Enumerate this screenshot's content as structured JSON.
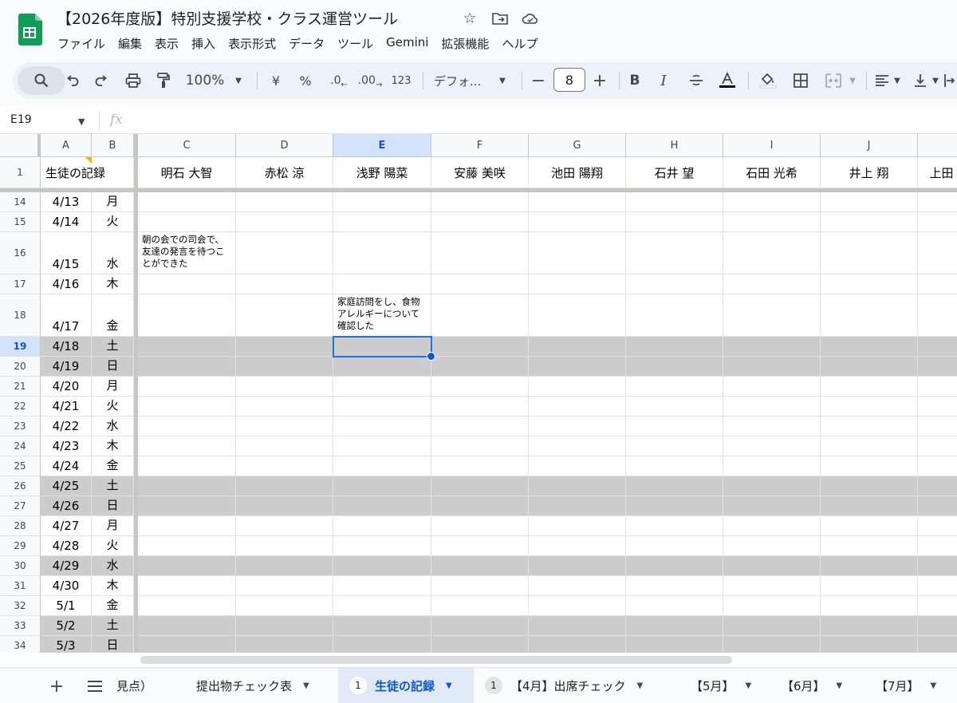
{
  "app": {
    "doc_title": "【2026年度版】特別支援学校・クラス運営ツール",
    "menu": [
      "ファイル",
      "編集",
      "表示",
      "挿入",
      "表示形式",
      "データ",
      "ツール",
      "Gemini",
      "拡張機能",
      "ヘルプ"
    ]
  },
  "toolbar": {
    "zoom": "100%",
    "currency": "¥",
    "percent": "%",
    "dec_decrease": ".0",
    "dec_increase": ".00",
    "number_format": "123",
    "font": "デフォ...",
    "font_size": "8"
  },
  "formula_bar": {
    "name_box": "E19",
    "fx_label": "fx",
    "formula": ""
  },
  "grid": {
    "col_headers": [
      "A",
      "B",
      "C",
      "D",
      "E",
      "F",
      "G",
      "H",
      "I",
      "J"
    ],
    "selected_col": "E",
    "header_row": {
      "row_num": "1",
      "label": "生徒の記録",
      "names": [
        "明石 大智",
        "赤松 涼",
        "浅野 陽菜",
        "安藤 美咲",
        "池田 陽翔",
        "石井 望",
        "石田 光希",
        "井上 翔",
        "上田"
      ]
    },
    "rows": [
      {
        "num": "14",
        "date": "4/13",
        "day": "月",
        "gray": false
      },
      {
        "num": "15",
        "date": "4/14",
        "day": "火",
        "gray": false
      },
      {
        "num": "16",
        "date": "4/15",
        "day": "水",
        "gray": false
      },
      {
        "num": "17",
        "date": "4/16",
        "day": "木",
        "gray": false
      },
      {
        "num": "18",
        "date": "4/17",
        "day": "金",
        "gray": false
      },
      {
        "num": "19",
        "date": "4/18",
        "day": "土",
        "gray": true
      },
      {
        "num": "20",
        "date": "4/19",
        "day": "日",
        "gray": true
      },
      {
        "num": "21",
        "date": "4/20",
        "day": "月",
        "gray": false
      },
      {
        "num": "22",
        "date": "4/21",
        "day": "火",
        "gray": false
      },
      {
        "num": "23",
        "date": "4/22",
        "day": "水",
        "gray": false
      },
      {
        "num": "24",
        "date": "4/23",
        "day": "木",
        "gray": false
      },
      {
        "num": "25",
        "date": "4/24",
        "day": "金",
        "gray": false
      },
      {
        "num": "26",
        "date": "4/25",
        "day": "土",
        "gray": true
      },
      {
        "num": "27",
        "date": "4/26",
        "day": "日",
        "gray": true
      },
      {
        "num": "28",
        "date": "4/27",
        "day": "月",
        "gray": false
      },
      {
        "num": "29",
        "date": "4/28",
        "day": "火",
        "gray": false
      },
      {
        "num": "30",
        "date": "4/29",
        "day": "水",
        "gray": true
      },
      {
        "num": "31",
        "date": "4/30",
        "day": "木",
        "gray": false
      },
      {
        "num": "32",
        "date": "5/1",
        "day": "金",
        "gray": false
      },
      {
        "num": "33",
        "date": "5/2",
        "day": "土",
        "gray": true
      },
      {
        "num": "34",
        "date": "5/3",
        "day": "日",
        "gray": true
      }
    ],
    "notes": {
      "row16_colC": "朝の会での司会で、友達の発言を待つことができた",
      "row18_colE": "家庭訪問をし、食物アレルギーについて確認した"
    }
  },
  "sheet_tabs": [
    {
      "label": "見点）",
      "badge": "",
      "active": false
    },
    {
      "label": "提出物チェック表",
      "badge": "",
      "active": false
    },
    {
      "label": "生徒の記録",
      "badge": "1",
      "active": true
    },
    {
      "label": "【4月】出席チェック",
      "badge": "1",
      "active": false
    },
    {
      "label": "【5月】",
      "badge": "",
      "active": false
    },
    {
      "label": "【6月】",
      "badge": "",
      "active": false
    },
    {
      "label": "【7月】",
      "badge": "",
      "active": false
    }
  ],
  "colors": {
    "accent": "#0b57d0",
    "weekend_fill": "#cccccc",
    "selection": "#1a73e8",
    "sheets_green": "#0f9d58"
  }
}
